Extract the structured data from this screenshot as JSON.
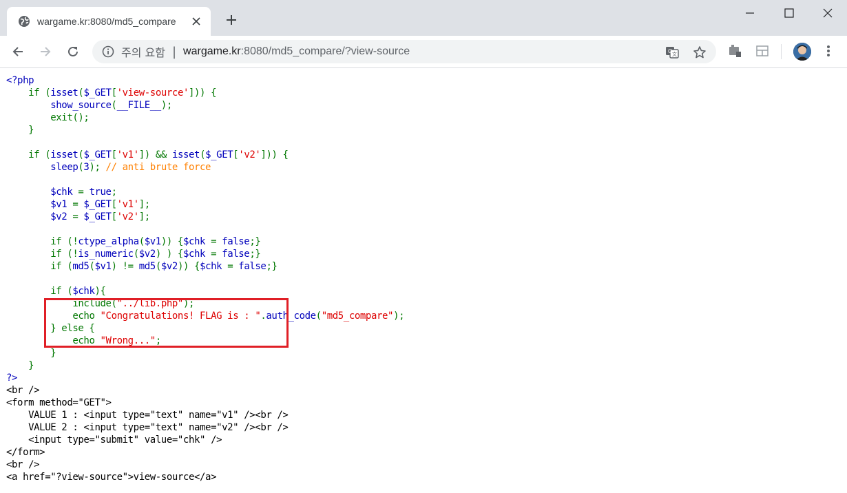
{
  "browser": {
    "tab_title": "wargame.kr:8080/md5_compare",
    "omnibox": {
      "security_label": "주의 요함",
      "separator": "|",
      "url_host": "wargame.kr",
      "url_rest": ":8080/md5_compare/?view-source"
    },
    "icons": {
      "tab_favicon": "globe-icon",
      "tab_close": "close-icon",
      "new_tab": "plus-icon",
      "minimize": "minimize-icon",
      "maximize": "maximize-icon",
      "window_close": "close-icon",
      "back": "arrow-left-icon",
      "forward": "arrow-right-icon",
      "reload": "reload-icon",
      "info": "info-icon",
      "translate": "translate-icon",
      "bookmark": "star-icon",
      "extension1": "extension-icon",
      "extension2": "layout-icon",
      "menu": "kebab-menu-icon"
    }
  },
  "code_lines": [
    [
      {
        "t": "&lt;?php",
        "c": "c-blue"
      }
    ],
    [
      {
        "t": "    ",
        "c": "c-blue"
      },
      {
        "t": "if (",
        "c": "c-green"
      },
      {
        "t": "isset",
        "c": "c-blue"
      },
      {
        "t": "(",
        "c": "c-green"
      },
      {
        "t": "$_GET",
        "c": "c-blue"
      },
      {
        "t": "[",
        "c": "c-green"
      },
      {
        "t": "'view-source'",
        "c": "c-red"
      },
      {
        "t": "])) {",
        "c": "c-green"
      }
    ],
    [
      {
        "t": "        show_source",
        "c": "c-blue"
      },
      {
        "t": "(",
        "c": "c-green"
      },
      {
        "t": "__FILE__",
        "c": "c-blue"
      },
      {
        "t": ");",
        "c": "c-green"
      }
    ],
    [
      {
        "t": "        ",
        "c": "c-blue"
      },
      {
        "t": "exit",
        "c": "c-green"
      },
      {
        "t": "();",
        "c": "c-green"
      }
    ],
    [
      {
        "t": "    }",
        "c": "c-green"
      }
    ],
    [
      {
        "t": "",
        "c": "c-green"
      }
    ],
    [
      {
        "t": "    ",
        "c": "c-blue"
      },
      {
        "t": "if (",
        "c": "c-green"
      },
      {
        "t": "isset",
        "c": "c-blue"
      },
      {
        "t": "(",
        "c": "c-green"
      },
      {
        "t": "$_GET",
        "c": "c-blue"
      },
      {
        "t": "[",
        "c": "c-green"
      },
      {
        "t": "'v1'",
        "c": "c-red"
      },
      {
        "t": "]) &amp;&amp; ",
        "c": "c-green"
      },
      {
        "t": "isset",
        "c": "c-blue"
      },
      {
        "t": "(",
        "c": "c-green"
      },
      {
        "t": "$_GET",
        "c": "c-blue"
      },
      {
        "t": "[",
        "c": "c-green"
      },
      {
        "t": "'v2'",
        "c": "c-red"
      },
      {
        "t": "])) {",
        "c": "c-green"
      }
    ],
    [
      {
        "t": "        sleep",
        "c": "c-blue"
      },
      {
        "t": "(",
        "c": "c-green"
      },
      {
        "t": "3",
        "c": "c-blue"
      },
      {
        "t": "); ",
        "c": "c-green"
      },
      {
        "t": "// anti brute force",
        "c": "c-orange"
      }
    ],
    [
      {
        "t": "",
        "c": "c-green"
      }
    ],
    [
      {
        "t": "        $chk ",
        "c": "c-blue"
      },
      {
        "t": "= ",
        "c": "c-green"
      },
      {
        "t": "true",
        "c": "c-blue"
      },
      {
        "t": ";",
        "c": "c-green"
      }
    ],
    [
      {
        "t": "        $v1 ",
        "c": "c-blue"
      },
      {
        "t": "= ",
        "c": "c-green"
      },
      {
        "t": "$_GET",
        "c": "c-blue"
      },
      {
        "t": "[",
        "c": "c-green"
      },
      {
        "t": "'v1'",
        "c": "c-red"
      },
      {
        "t": "];",
        "c": "c-green"
      }
    ],
    [
      {
        "t": "        $v2 ",
        "c": "c-blue"
      },
      {
        "t": "= ",
        "c": "c-green"
      },
      {
        "t": "$_GET",
        "c": "c-blue"
      },
      {
        "t": "[",
        "c": "c-green"
      },
      {
        "t": "'v2'",
        "c": "c-red"
      },
      {
        "t": "];",
        "c": "c-green"
      }
    ],
    [
      {
        "t": "",
        "c": "c-green"
      }
    ],
    [
      {
        "t": "        ",
        "c": "c-blue"
      },
      {
        "t": "if (!",
        "c": "c-green"
      },
      {
        "t": "ctype_alpha",
        "c": "c-blue"
      },
      {
        "t": "(",
        "c": "c-green"
      },
      {
        "t": "$v1",
        "c": "c-blue"
      },
      {
        "t": ")) {",
        "c": "c-green"
      },
      {
        "t": "$chk ",
        "c": "c-blue"
      },
      {
        "t": "= ",
        "c": "c-green"
      },
      {
        "t": "false",
        "c": "c-blue"
      },
      {
        "t": ";}",
        "c": "c-green"
      }
    ],
    [
      {
        "t": "        ",
        "c": "c-blue"
      },
      {
        "t": "if (!",
        "c": "c-green"
      },
      {
        "t": "is_numeric",
        "c": "c-blue"
      },
      {
        "t": "(",
        "c": "c-green"
      },
      {
        "t": "$v2",
        "c": "c-blue"
      },
      {
        "t": ") ) {",
        "c": "c-green"
      },
      {
        "t": "$chk ",
        "c": "c-blue"
      },
      {
        "t": "= ",
        "c": "c-green"
      },
      {
        "t": "false",
        "c": "c-blue"
      },
      {
        "t": ";}",
        "c": "c-green"
      }
    ],
    [
      {
        "t": "        ",
        "c": "c-blue"
      },
      {
        "t": "if (",
        "c": "c-green"
      },
      {
        "t": "md5",
        "c": "c-blue"
      },
      {
        "t": "(",
        "c": "c-green"
      },
      {
        "t": "$v1",
        "c": "c-blue"
      },
      {
        "t": ") != ",
        "c": "c-green"
      },
      {
        "t": "md5",
        "c": "c-blue"
      },
      {
        "t": "(",
        "c": "c-green"
      },
      {
        "t": "$v2",
        "c": "c-blue"
      },
      {
        "t": ")) {",
        "c": "c-green"
      },
      {
        "t": "$chk ",
        "c": "c-blue"
      },
      {
        "t": "= ",
        "c": "c-green"
      },
      {
        "t": "false",
        "c": "c-blue"
      },
      {
        "t": ";}",
        "c": "c-green"
      }
    ],
    [
      {
        "t": "",
        "c": "c-green"
      }
    ],
    [
      {
        "t": "        ",
        "c": "c-blue"
      },
      {
        "t": "if (",
        "c": "c-green"
      },
      {
        "t": "$chk",
        "c": "c-blue"
      },
      {
        "t": "){",
        "c": "c-green"
      }
    ],
    [
      {
        "t": "            ",
        "c": "c-blue"
      },
      {
        "t": "include(",
        "c": "c-green"
      },
      {
        "t": "\"../lib.php\"",
        "c": "c-red"
      },
      {
        "t": ");",
        "c": "c-green"
      }
    ],
    [
      {
        "t": "            ",
        "c": "c-blue"
      },
      {
        "t": "echo ",
        "c": "c-green"
      },
      {
        "t": "\"Congratulations! FLAG is : \"",
        "c": "c-red"
      },
      {
        "t": ".",
        "c": "c-green"
      },
      {
        "t": "auth_code",
        "c": "c-blue"
      },
      {
        "t": "(",
        "c": "c-green"
      },
      {
        "t": "\"md5_compare\"",
        "c": "c-red"
      },
      {
        "t": ");",
        "c": "c-green"
      }
    ],
    [
      {
        "t": "        } else {",
        "c": "c-green"
      }
    ],
    [
      {
        "t": "            ",
        "c": "c-blue"
      },
      {
        "t": "echo ",
        "c": "c-green"
      },
      {
        "t": "\"Wrong...\"",
        "c": "c-red"
      },
      {
        "t": ";",
        "c": "c-green"
      }
    ],
    [
      {
        "t": "        }",
        "c": "c-green"
      }
    ],
    [
      {
        "t": "    }",
        "c": "c-green"
      }
    ],
    [
      {
        "t": "?&gt;",
        "c": "c-blue"
      }
    ],
    [
      {
        "t": "&lt;br /&gt;",
        "c": "c-black"
      }
    ],
    [
      {
        "t": "&lt;form method=\"GET\"&gt;",
        "c": "c-black"
      }
    ],
    [
      {
        "t": "    VALUE 1 : &lt;input type=\"text\" name=\"v1\" /&gt;&lt;br /&gt;",
        "c": "c-black"
      }
    ],
    [
      {
        "t": "    VALUE 2 : &lt;input type=\"text\" name=\"v2\" /&gt;&lt;br /&gt;",
        "c": "c-black"
      }
    ],
    [
      {
        "t": "    &lt;input type=\"submit\" value=\"chk\" /&gt;",
        "c": "c-black"
      }
    ],
    [
      {
        "t": "&lt;/form&gt;",
        "c": "c-black"
      }
    ],
    [
      {
        "t": "&lt;br /&gt;",
        "c": "c-black"
      }
    ],
    [
      {
        "t": "&lt;a href=\"?view-source\"&gt;view-source&lt;/a&gt;",
        "c": "c-black"
      }
    ]
  ],
  "colors": {
    "php_default": "#0000bb",
    "php_keyword": "#007700",
    "php_string": "#dd0000",
    "php_comment": "#ff8000",
    "html": "#000000",
    "highlight_border": "#e01f26"
  }
}
